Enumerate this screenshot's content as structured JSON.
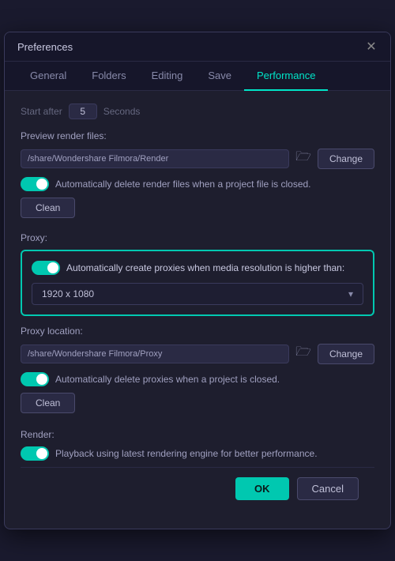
{
  "dialog": {
    "title": "Preferences",
    "close_label": "✕"
  },
  "tabs": [
    {
      "id": "general",
      "label": "General",
      "active": false
    },
    {
      "id": "folders",
      "label": "Folders",
      "active": false
    },
    {
      "id": "editing",
      "label": "Editing",
      "active": false
    },
    {
      "id": "save",
      "label": "Save",
      "active": false
    },
    {
      "id": "performance",
      "label": "Performance",
      "active": true
    }
  ],
  "performance": {
    "start_after_label": "Start after",
    "start_after_value": "5",
    "start_after_unit": "Seconds",
    "preview_render_label": "Preview render files:",
    "preview_render_path": "/share/Wondershare Filmora/Render",
    "preview_change_btn": "Change",
    "preview_auto_delete_label": "Automatically delete render files when a project file is closed.",
    "preview_clean_btn": "Clean",
    "proxy_label": "Proxy:",
    "proxy_auto_create_label": "Automatically create proxies when media resolution is higher than:",
    "proxy_resolution": "1920 x 1080",
    "proxy_location_label": "Proxy location:",
    "proxy_location_path": "/share/Wondershare Filmora/Proxy",
    "proxy_change_btn": "Change",
    "proxy_auto_delete_label": "Automatically delete proxies when a project is closed.",
    "proxy_clean_btn": "Clean",
    "render_label": "Render:",
    "render_playback_label": "Playback using latest rendering engine for better performance.",
    "ok_btn": "OK",
    "cancel_btn": "Cancel"
  }
}
